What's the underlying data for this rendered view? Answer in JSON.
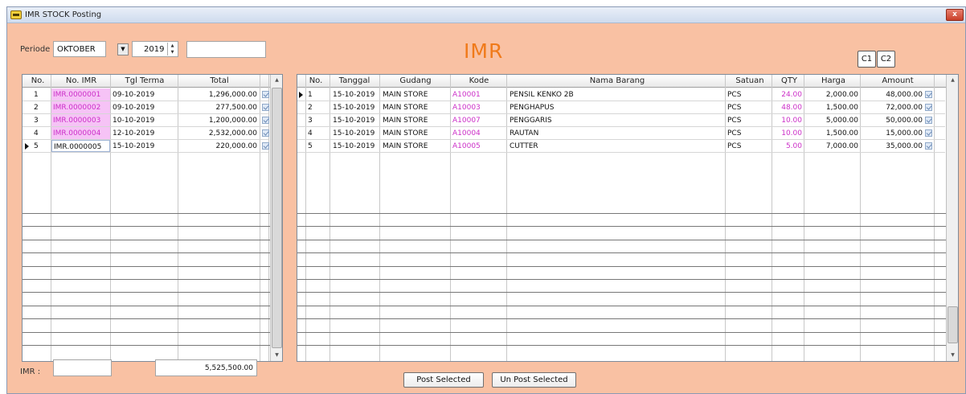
{
  "window": {
    "title": "IMR STOCK Posting",
    "close_label": "x"
  },
  "header": {
    "periode_label": "Periode",
    "month": "OKTOBER",
    "year": "2019",
    "title": "IMR"
  },
  "buttons": {
    "c1": "C1",
    "c2": "C2",
    "post_selected": "Post Selected",
    "unpost_selected": "Un Post Selected"
  },
  "left_grid": {
    "columns": [
      "No.",
      "No. IMR",
      "Tgl Terma",
      "Total"
    ],
    "rows": [
      {
        "no": "1",
        "imr": "IMR.0000001",
        "date": "09-10-2019",
        "total": "1,296,000.00"
      },
      {
        "no": "2",
        "imr": "IMR.0000002",
        "date": "09-10-2019",
        "total": "277,500.00"
      },
      {
        "no": "3",
        "imr": "IMR.0000003",
        "date": "10-10-2019",
        "total": "1,200,000.00"
      },
      {
        "no": "4",
        "imr": "IMR.0000004",
        "date": "12-10-2019",
        "total": "2,532,000.00"
      },
      {
        "no": "5",
        "imr": "IMR.0000005",
        "date": "15-10-2019",
        "total": "220,000.00"
      }
    ]
  },
  "right_grid": {
    "columns": [
      "No.",
      "Tanggal",
      "Gudang",
      "Kode",
      "Nama Barang",
      "Satuan",
      "QTY",
      "Harga",
      "Amount"
    ],
    "rows": [
      {
        "no": "1",
        "date": "15-10-2019",
        "gudang": "MAIN STORE",
        "kode": "A10001",
        "nama": "PENSIL KENKO 2B",
        "satuan": "PCS",
        "qty": "24.00",
        "harga": "2,000.00",
        "amount": "48,000.00"
      },
      {
        "no": "2",
        "date": "15-10-2019",
        "gudang": "MAIN STORE",
        "kode": "A10003",
        "nama": "PENGHAPUS",
        "satuan": "PCS",
        "qty": "48.00",
        "harga": "1,500.00",
        "amount": "72,000.00"
      },
      {
        "no": "3",
        "date": "15-10-2019",
        "gudang": "MAIN STORE",
        "kode": "A10007",
        "nama": "PENGGARIS",
        "satuan": "PCS",
        "qty": "10.00",
        "harga": "5,000.00",
        "amount": "50,000.00"
      },
      {
        "no": "4",
        "date": "15-10-2019",
        "gudang": "MAIN STORE",
        "kode": "A10004",
        "nama": "RAUTAN",
        "satuan": "PCS",
        "qty": "10.00",
        "harga": "1,500.00",
        "amount": "15,000.00"
      },
      {
        "no": "5",
        "date": "15-10-2019",
        "gudang": "MAIN STORE",
        "kode": "A10005",
        "nama": "CUTTER",
        "satuan": "PCS",
        "qty": "5.00",
        "harga": "7,000.00",
        "amount": "35,000.00"
      }
    ]
  },
  "footer": {
    "imr_label": "IMR :",
    "grand_total": "5,525,500.00"
  },
  "colors": {
    "background": "#f9c1a3",
    "title_accent": "#f07a1a",
    "code_text": "#cc2fc8",
    "imr_highlight": "#f6c3f6"
  }
}
